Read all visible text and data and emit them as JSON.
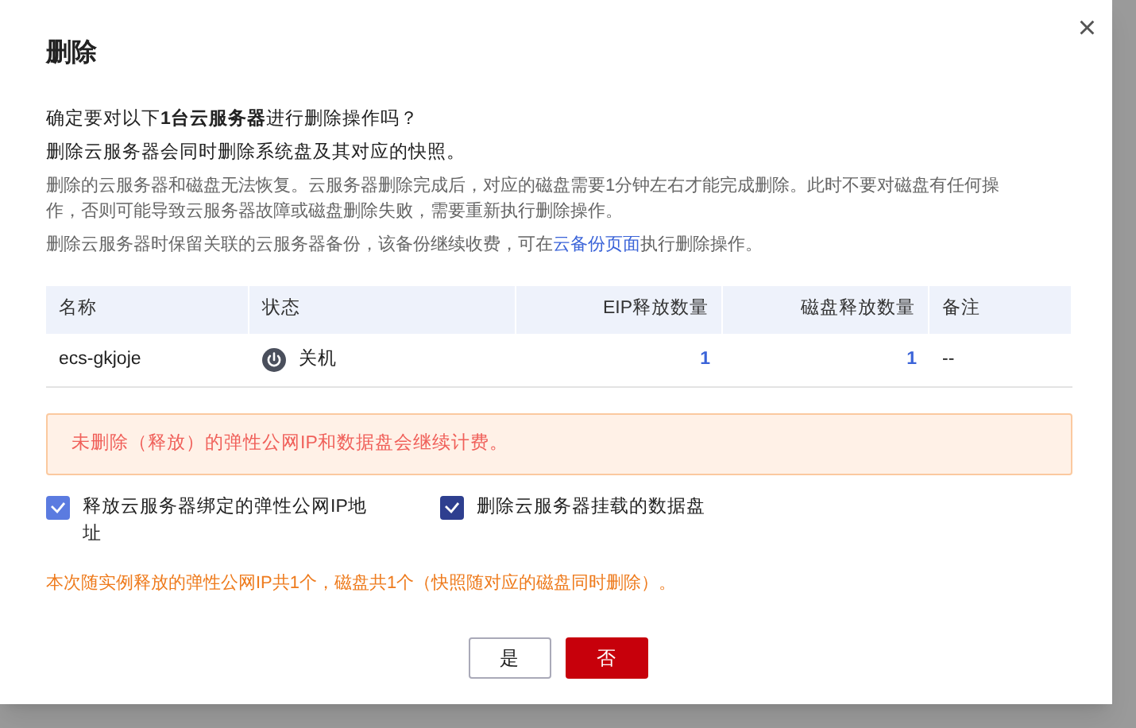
{
  "dialog": {
    "title": "删除",
    "close_icon": "×",
    "intro": [
      "确定要对以下**1台云服务器**进行删除操作吗？",
      "删除云服务器会同时删除系统盘及其对应的快照。"
    ],
    "notes": [
      {
        "text": "删除的云服务器和磁盘无法恢复。云服务器删除完成后，对应的磁盘需要1分钟左右才能完成删除。此时不要对磁盘有任何操作，否则可能导致云服务器故障或磁盘删除失败，需要重新执行删除操作。"
      },
      {
        "text": "删除云服务器时保留关联的云服务器备份，该备份继续收费，可在",
        "link": "云备份页面",
        "after": "执行删除操作。"
      }
    ],
    "table": {
      "columns": [
        "名称",
        "状态",
        "EIP释放数量",
        "磁盘释放数量",
        "备注"
      ],
      "rows": [
        {
          "name": "ecs-gkjoje",
          "status": "关机",
          "eip": "1",
          "disk": "1",
          "remark": "--"
        }
      ]
    },
    "warning": "未删除（释放）的弹性公网IP和数据盘会继续计费。",
    "options": [
      {
        "label": "释放云服务器绑定的弹性公网IP地址",
        "checked": true,
        "color": "#5b7be0"
      },
      {
        "label": "删除云服务器挂载的数据盘",
        "checked": true,
        "color": "#2e3f8f"
      }
    ],
    "summary": "本次随实例释放的弹性公网IP共1个，磁盘共1个（快照随对应的磁盘同时删除）。",
    "buttons": [
      {
        "label": "是",
        "kind": "secondary"
      },
      {
        "label": "否",
        "kind": "primary"
      }
    ]
  }
}
